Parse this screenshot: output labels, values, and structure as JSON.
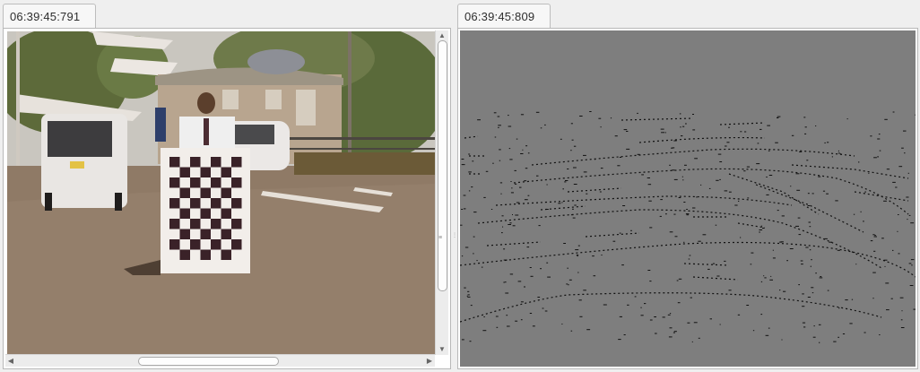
{
  "left_panel": {
    "timestamp": "06:39:45:791",
    "image_description_icon": "camera-color-image"
  },
  "right_panel": {
    "timestamp": "06:39:45:809",
    "image_description_icon": "edge-detection-image"
  },
  "scrollbars": {
    "vertical_position": 0.0,
    "horizontal_position": 0.33
  },
  "colors": {
    "window_bg": "#efefef",
    "edge_bg": "#7e7e7e",
    "edge_line": "#111111"
  }
}
